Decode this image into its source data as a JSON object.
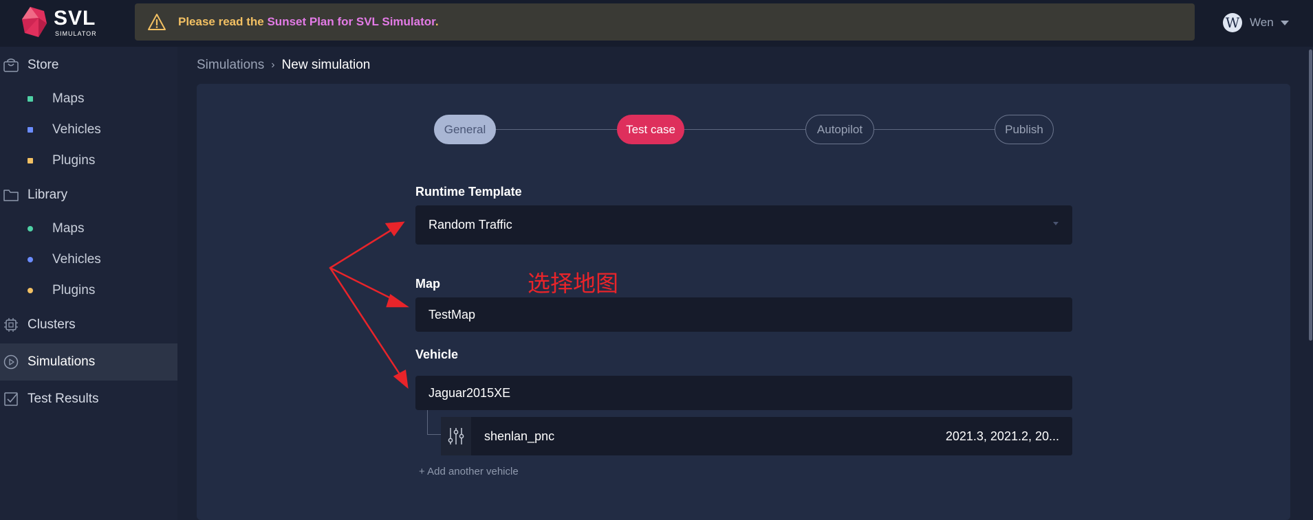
{
  "app": {
    "logo_name": "SVL",
    "logo_sub": "SIMULATOR",
    "accent_color": "#de2f5c"
  },
  "banner": {
    "icon": "warning-triangle-icon",
    "prefix": "Please read the ",
    "link": "Sunset Plan for SVL Simulator",
    "suffix": "."
  },
  "user": {
    "initial": "W",
    "name": "Wen"
  },
  "sidebar": {
    "store": {
      "label": "Store",
      "icon": "shopping-bag-icon",
      "items": [
        {
          "label": "Maps",
          "color": "#4fd1a5"
        },
        {
          "label": "Vehicles",
          "color": "#6b8cff"
        },
        {
          "label": "Plugins",
          "color": "#f2c063"
        }
      ]
    },
    "library": {
      "label": "Library",
      "icon": "folder-icon",
      "items": [
        {
          "label": "Maps",
          "color": "#4fd1a5"
        },
        {
          "label": "Vehicles",
          "color": "#6b8cff"
        },
        {
          "label": "Plugins",
          "color": "#f2c063"
        }
      ]
    },
    "clusters": {
      "label": "Clusters",
      "icon": "chip-icon"
    },
    "simulations": {
      "label": "Simulations",
      "icon": "play-circle-icon"
    },
    "test_results": {
      "label": "Test Results",
      "icon": "checkbox-icon"
    }
  },
  "breadcrumb": {
    "parent": "Simulations",
    "separator": "›",
    "current": "New simulation"
  },
  "stepper": {
    "steps": [
      "General",
      "Test case",
      "Autopilot",
      "Publish"
    ],
    "active": "Test case"
  },
  "form": {
    "runtime_template": {
      "label": "Runtime Template",
      "value": "Random Traffic"
    },
    "map": {
      "label": "Map",
      "value": "TestMap"
    },
    "vehicle": {
      "label": "Vehicle",
      "value": "Jaguar2015XE",
      "sensor_config": {
        "icon": "sliders-icon",
        "name": "shenlan_pnc",
        "versions": "2021.3, 2021.2, 20..."
      },
      "add_label": "+ Add another vehicle"
    }
  },
  "annotation": {
    "text": "选择地图",
    "color": "#e8242a"
  }
}
